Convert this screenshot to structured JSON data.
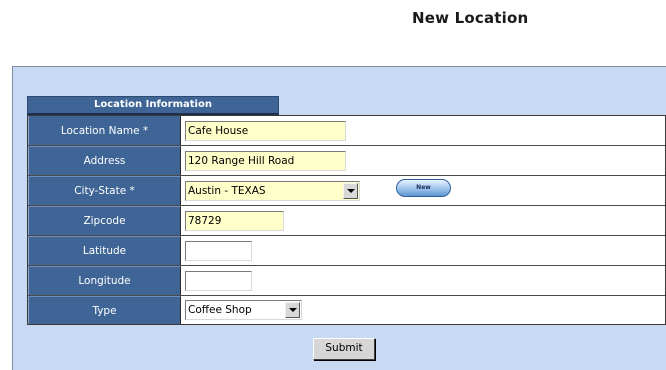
{
  "page": {
    "title": "New Location"
  },
  "form": {
    "section_title": "Location Information",
    "fields": {
      "location_name": {
        "label": "Location Name *",
        "value": "Cafe House"
      },
      "address": {
        "label": "Address",
        "value": "120 Range Hill Road"
      },
      "city_state": {
        "label": "City-State *",
        "value": "Austin - TEXAS",
        "new_button": "New"
      },
      "zipcode": {
        "label": "Zipcode",
        "value": "78729"
      },
      "latitude": {
        "label": "Latitude",
        "value": ""
      },
      "longitude": {
        "label": "Longitude",
        "value": ""
      },
      "type": {
        "label": "Type",
        "value": "Coffee Shop"
      }
    },
    "submit_label": "Submit"
  },
  "colors": {
    "label_background": "#3f6596",
    "panel_background": "#c7d9f3",
    "required_field_background": "#ffffc9"
  }
}
